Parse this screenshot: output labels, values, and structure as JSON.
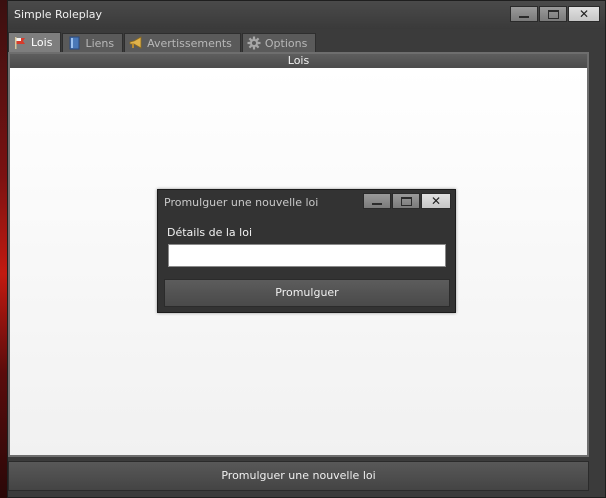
{
  "window": {
    "title": "Simple Roleplay"
  },
  "tabs": [
    {
      "label": "Lois",
      "icon": "flag-icon",
      "active": true
    },
    {
      "label": "Liens",
      "icon": "book-icon",
      "active": false
    },
    {
      "label": "Avertissements",
      "icon": "megaphone-icon",
      "active": false
    },
    {
      "label": "Options",
      "icon": "gear-icon",
      "active": false
    }
  ],
  "panel": {
    "header": "Lois"
  },
  "footer": {
    "button_label": "Promulguer une nouvelle loi"
  },
  "dialog": {
    "title": "Promulguer une nouvelle loi",
    "field_label": "Détails de la loi",
    "field_value": "",
    "submit_label": "Promulguer"
  },
  "colors": {
    "window_bg": "#3b3b3b",
    "active_tab": "#7e7e7e",
    "panel_bg": "#f7f7f7",
    "dialog_bg": "#333333"
  }
}
